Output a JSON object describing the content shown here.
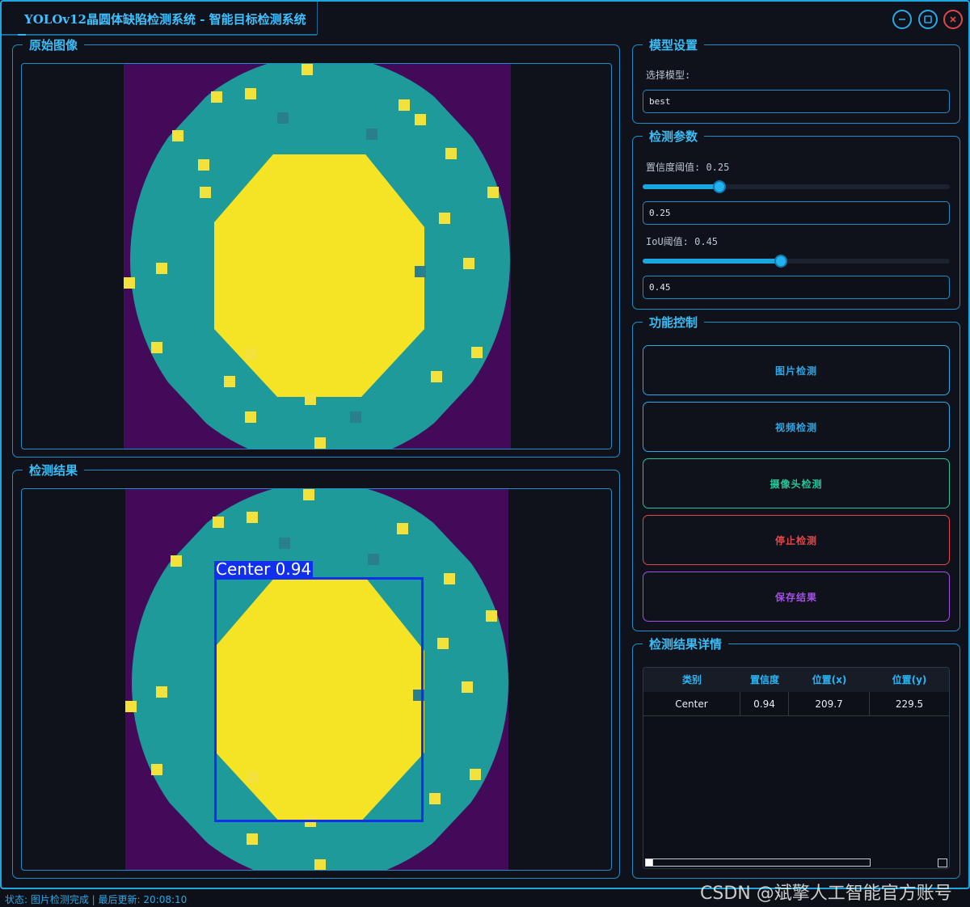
{
  "window": {
    "title": "YOLOv12晶圆体缺陷检测系统 - 智能目标检测系统",
    "accent_color": "#1ea6e0",
    "close_color": "#e04848"
  },
  "panels": {
    "original": {
      "title": "原始图像"
    },
    "result": {
      "title": "检测结果",
      "detection_label": "Center 0.94"
    }
  },
  "model_settings": {
    "title": "模型设置",
    "select_label": "选择模型:",
    "selected_model": "best"
  },
  "detection_params": {
    "title": "检测参数",
    "confidence_label": "置信度阈值: 0.25",
    "confidence_value": "0.25",
    "confidence_fraction": 0.25,
    "iou_label": "IoU阈值: 0.45",
    "iou_value": "0.45",
    "iou_fraction": 0.45
  },
  "function_control": {
    "title": "功能控制",
    "buttons": [
      {
        "label": "图片检测",
        "color": "#2ea8e6"
      },
      {
        "label": "视频检测",
        "color": "#2ea8e6"
      },
      {
        "label": "摄像头检测",
        "color": "#26c59a"
      },
      {
        "label": "停止检测",
        "color": "#e5474a"
      },
      {
        "label": "保存结果",
        "color": "#a350e6"
      }
    ]
  },
  "results_detail": {
    "title": "检测结果详情",
    "columns": [
      "类别",
      "置信度",
      "位置(x)",
      "位置(y)"
    ],
    "rows": [
      [
        "Center",
        "0.94",
        "209.7",
        "229.5"
      ]
    ]
  },
  "status_bar": {
    "text": "状态: 图片检测完成 | 最后更新: 20:08:10"
  },
  "watermark": "CSDN @斌擎人工智能官方账号"
}
